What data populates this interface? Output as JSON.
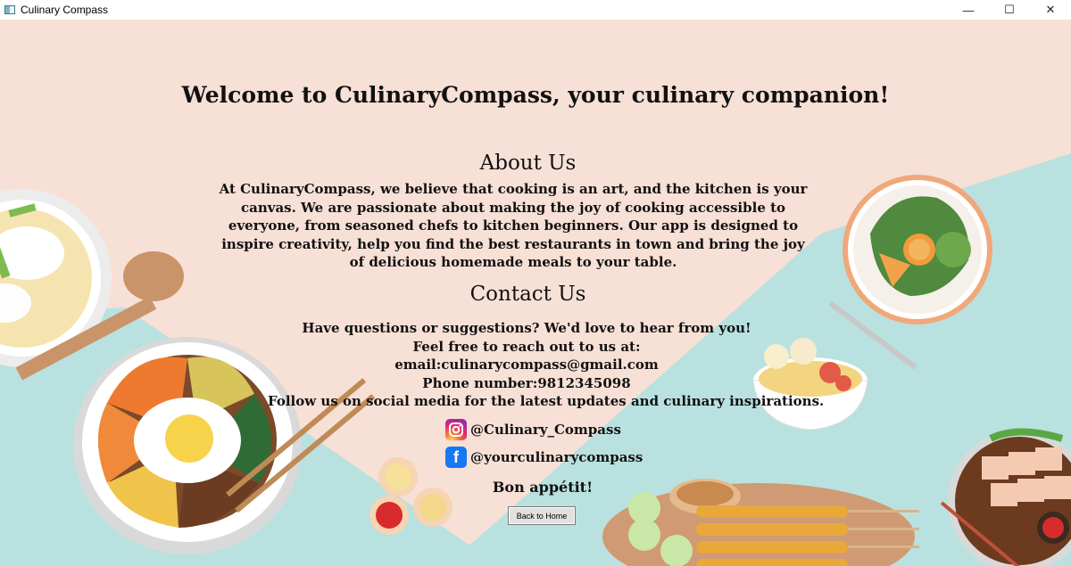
{
  "window": {
    "title": "Culinary Compass",
    "controls": {
      "minimize": "—",
      "maximize": "☐",
      "close": "✕"
    }
  },
  "page": {
    "welcome": "Welcome to CulinaryCompass, your culinary companion!",
    "about_title": "About Us",
    "about_body": "At CulinaryCompass, we believe that cooking is an art, and the kitchen is your canvas. We are passionate about making the joy of cooking accessible to everyone, from seasoned chefs to kitchen beginners. Our app is designed to inspire creativity, help you find the best restaurants in town and bring the joy of delicious homemade meals to your table.",
    "contact_title": "Contact Us",
    "contact_intro": "Have questions or suggestions? We'd love to hear from you! Feel free to reach out to us at:",
    "email": "email:culinarycompass@gmail.com",
    "phone": "Phone number:9812345098",
    "follow": "Follow us on social media for the latest updates and culinary inspirations.",
    "instagram": "@Culinary_Compass",
    "facebook": "@yourculinarycompass",
    "bon_appetit": "Bon appétit!",
    "back_button": "Back to Home"
  },
  "colors": {
    "background_peach": "#f7e0d6",
    "background_teal": "#b8e0df",
    "button_face": "#e1e1e1"
  },
  "icons": {
    "instagram": "instagram-icon",
    "facebook": "facebook-icon"
  }
}
